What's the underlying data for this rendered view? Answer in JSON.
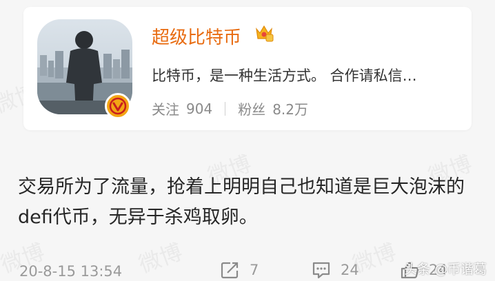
{
  "profile": {
    "name": "超级比特币",
    "bio": "比特币，是一种生活方式。 合作请私信…",
    "following_label": "关注",
    "following_count": "904",
    "followers_label": "粉丝",
    "followers_count": "8.2万"
  },
  "post": {
    "text": "交易所为了流量，抢着上明明自己也知道是巨大泡沫的defi代币，无异于杀鸡取卵。",
    "time": "20-8-15 13:54",
    "reposts": "7",
    "comments": "24",
    "likes": "24"
  },
  "source_label": "头条 @币谐葛",
  "watermark_text": "微博",
  "colors": {
    "name": "#e86b10",
    "badge": "#f3a514",
    "background": "#f6f6f6"
  }
}
